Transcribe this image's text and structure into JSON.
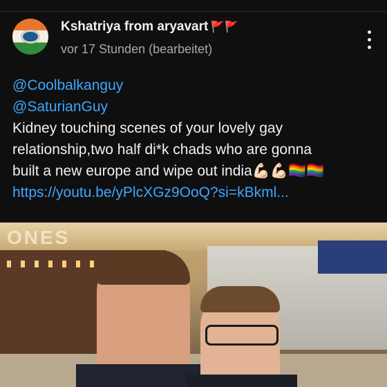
{
  "comment": {
    "author": "Kshatriya from aryavart",
    "author_flags": "🚩🚩",
    "time": "vor 17 Stunden (bearbeitet)",
    "lines": [
      {
        "kind": "mention",
        "text": "@Coolbalkanguy"
      },
      {
        "kind": "mention",
        "text": "@SaturianGuy"
      },
      {
        "kind": "text",
        "text": "Kidney touching scenes of your lovely gay"
      },
      {
        "kind": "text",
        "text": "relationship,two half di*k chads who are gonna"
      },
      {
        "kind": "text",
        "text": "built a new europe and wipe out india💪🏻💪🏻🏳️‍🌈🏳️‍🌈"
      },
      {
        "kind": "link",
        "text": "https://youtu.be/yPlcXGz9OoQ?si=kBkml..."
      }
    ],
    "image_alt_sign": "ONES"
  },
  "icons": {
    "avatar": "avatar-eye-tricolor",
    "menu": "more-vertical-icon"
  }
}
